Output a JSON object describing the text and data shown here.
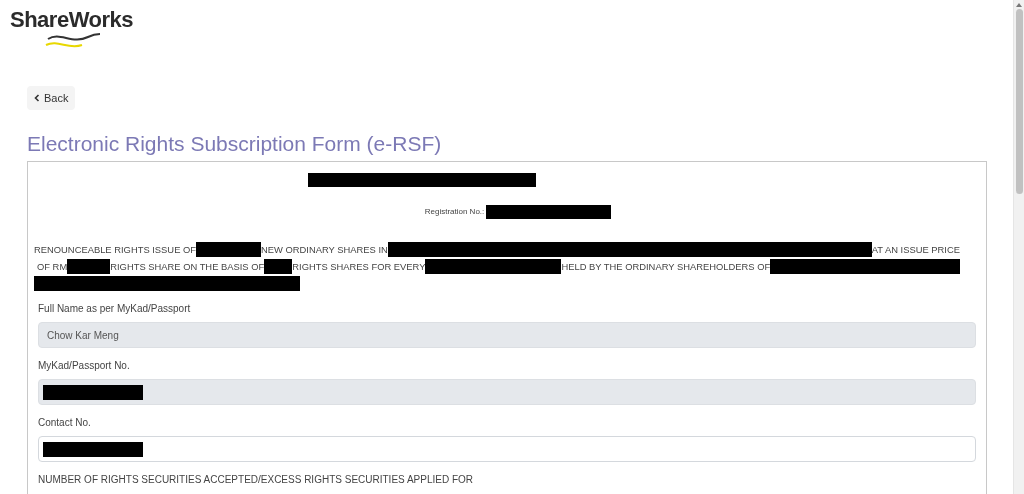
{
  "logo": {
    "text": "ShareWorks"
  },
  "back_button": {
    "label": "Back"
  },
  "title": "Electronic Rights Subscription Form (e-RSF)",
  "form": {
    "header_lines": [
      {
        "segments": [
          {
            "kind": "redacted"
          }
        ]
      },
      {
        "segments": [
          {
            "kind": "text",
            "text": "Registration No.:"
          },
          {
            "kind": "redacted"
          }
        ]
      }
    ],
    "offer_text": [
      {
        "kind": "text",
        "text": "RENOUNCEABLE RIGHTS ISSUE OF"
      },
      {
        "kind": "redacted"
      },
      {
        "kind": "text",
        "text": "NEW ORDINARY SHARES IN"
      },
      {
        "kind": "redacted"
      },
      {
        "kind": "text",
        "text": "AT AN ISSUE PRICE"
      },
      {
        "kind": "text",
        "text": "OF RM"
      },
      {
        "kind": "redacted"
      },
      {
        "kind": "text",
        "text": "RIGHTS SHARE ON THE BASIS OF"
      },
      {
        "kind": "redacted"
      },
      {
        "kind": "text",
        "text": "RIGHTS SHARES FOR EVERY"
      },
      {
        "kind": "redacted"
      },
      {
        "kind": "text",
        "text": "HELD BY THE ORDINARY SHAREHOLDERS OF"
      },
      {
        "kind": "redacted"
      },
      {
        "kind": "redacted"
      }
    ],
    "fields": [
      {
        "label": "Full Name as per MyKad/Passport",
        "value": "Chow Kar Meng",
        "readonly": true
      },
      {
        "label": "MyKad/Passport No.",
        "redacted": true,
        "readonly": true
      },
      {
        "label": "Contact No.",
        "redacted": true,
        "readonly": false
      }
    ],
    "section_heading": "NUMBER OF RIGHTS SECURITIES ACCEPTED/EXCESS RIGHTS SECURITIES APPLIED FOR"
  }
}
